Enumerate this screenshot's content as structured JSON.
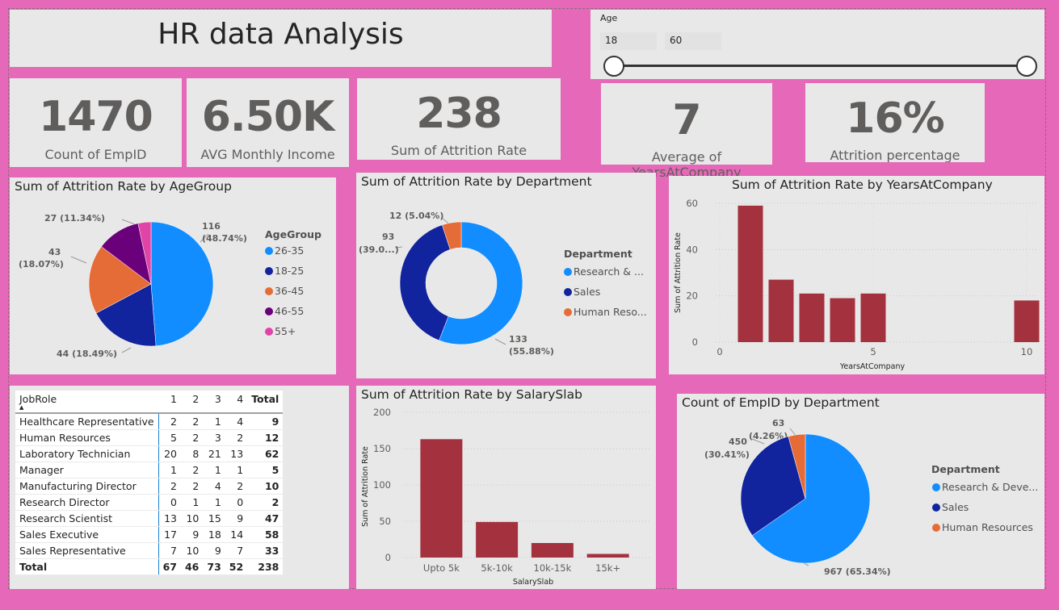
{
  "title": "HR data Analysis",
  "age_slicer": {
    "label": "Age",
    "min": "18",
    "max": "60"
  },
  "kpis": [
    {
      "value": "1470",
      "label": "Count of EmpID"
    },
    {
      "value": "6.50K",
      "label": "AVG Monthly Income"
    },
    {
      "value": "238",
      "label": "Sum of Attrition Rate"
    },
    {
      "value": "7",
      "label": "Average of YearsAtCompany"
    },
    {
      "value": "16%",
      "label": "Attrition percentage"
    }
  ],
  "colors": {
    "background": "#e668b8",
    "card": "#e8e8e8",
    "bar": "#a4313e",
    "blue": "#118dff",
    "navy": "#12239e",
    "orange": "#e66c37",
    "purple": "#6b007b",
    "pink": "#e044a7"
  },
  "chart_data": [
    {
      "type": "pie",
      "title": "Sum of Attrition Rate by AgeGroup",
      "legend_title": "AgeGroup",
      "categories": [
        "26-35",
        "18-25",
        "36-45",
        "46-55",
        "55+"
      ],
      "values": [
        116,
        44,
        43,
        27,
        8
      ],
      "data_labels": [
        "116",
        "(48.74%)",
        "44 (18.49%)",
        "43",
        "(18.07%)",
        "27 (11.34%)"
      ]
    },
    {
      "type": "pie",
      "title": "Sum of Attrition Rate by Department",
      "legend_title": "Department",
      "categories": [
        "Research & ...",
        "Sales",
        "Human Reso..."
      ],
      "values": [
        133,
        93,
        12
      ],
      "data_labels": [
        "133",
        "(55.88%)",
        "93",
        "(39.0...)",
        "12 (5.04%)"
      ]
    },
    {
      "type": "bar",
      "title": "Sum of Attrition Rate by YearsAtCompany",
      "xlabel": "YearsAtCompany",
      "ylabel": "Sum of Attrition Rate",
      "x": [
        1,
        2,
        3,
        4,
        5,
        10
      ],
      "values": [
        59,
        27,
        21,
        19,
        21,
        18
      ],
      "x_ticks": [
        "0",
        "5",
        "10"
      ],
      "y_ticks": [
        "0",
        "20",
        "40",
        "60"
      ],
      "xlim": [
        0,
        10
      ],
      "ylim": [
        0,
        60
      ]
    },
    {
      "type": "bar",
      "title": "Sum of Attrition Rate by SalarySlab",
      "xlabel": "SalarySlab",
      "ylabel": "Sum of Attrition Rate",
      "categories": [
        "Upto 5k",
        "5k-10k",
        "10k-15k",
        "15k+"
      ],
      "values": [
        163,
        49,
        20,
        5
      ],
      "y_ticks": [
        "0",
        "50",
        "100",
        "150",
        "200"
      ],
      "ylim": [
        0,
        200
      ]
    },
    {
      "type": "pie",
      "title": "Count of EmpID by Department",
      "legend_title": "Department",
      "categories": [
        "Research & Deve...",
        "Sales",
        "Human Resources"
      ],
      "values": [
        967,
        450,
        63
      ],
      "data_labels": [
        "967 (65.34%)",
        "450",
        "(30.41%)",
        "63",
        "(4.26%)"
      ]
    },
    {
      "type": "table",
      "columns": [
        "JobRole",
        "1",
        "2",
        "3",
        "4",
        "Total"
      ],
      "rows": [
        [
          "Healthcare Representative",
          "2",
          "2",
          "1",
          "4",
          "9"
        ],
        [
          "Human Resources",
          "5",
          "2",
          "3",
          "2",
          "12"
        ],
        [
          "Laboratory Technician",
          "20",
          "8",
          "21",
          "13",
          "62"
        ],
        [
          "Manager",
          "1",
          "2",
          "1",
          "1",
          "5"
        ],
        [
          "Manufacturing Director",
          "2",
          "2",
          "4",
          "2",
          "10"
        ],
        [
          "Research Director",
          "0",
          "1",
          "1",
          "0",
          "2"
        ],
        [
          "Research Scientist",
          "13",
          "10",
          "15",
          "9",
          "47"
        ],
        [
          "Sales Executive",
          "17",
          "9",
          "18",
          "14",
          "58"
        ],
        [
          "Sales Representative",
          "7",
          "10",
          "9",
          "7",
          "33"
        ]
      ],
      "total_row": [
        "Total",
        "67",
        "46",
        "73",
        "52",
        "238"
      ]
    }
  ]
}
